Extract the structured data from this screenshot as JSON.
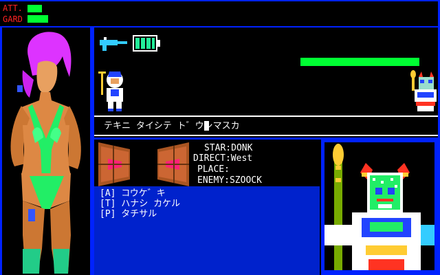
{
  "status": {
    "att_label": "ATT.",
    "gard_label": "GARD",
    "att_value": 0.55,
    "gard_value": 0.8
  },
  "enemy_hp": 0.95,
  "dialog": {
    "message": "テキニ タイシテ ト゛ウシマスカ"
  },
  "info": {
    "star": "STAR:DONK",
    "direct": "DIRECT:West",
    "place": "PLACE:",
    "enemy": "ENEMY:SZOOCK"
  },
  "commands": [
    {
      "label": "[A] コウケ゛キ"
    },
    {
      "label": "[T] ハナシ カケル"
    },
    {
      "label": "[P] タチサル"
    }
  ],
  "colors": {
    "frame": "#0022ff",
    "green": "#00ff33",
    "red": "#ff2222",
    "panel": "#0022cc"
  },
  "icons": {
    "weapon": "blaster-gun-icon",
    "battery": "battery-icon"
  }
}
